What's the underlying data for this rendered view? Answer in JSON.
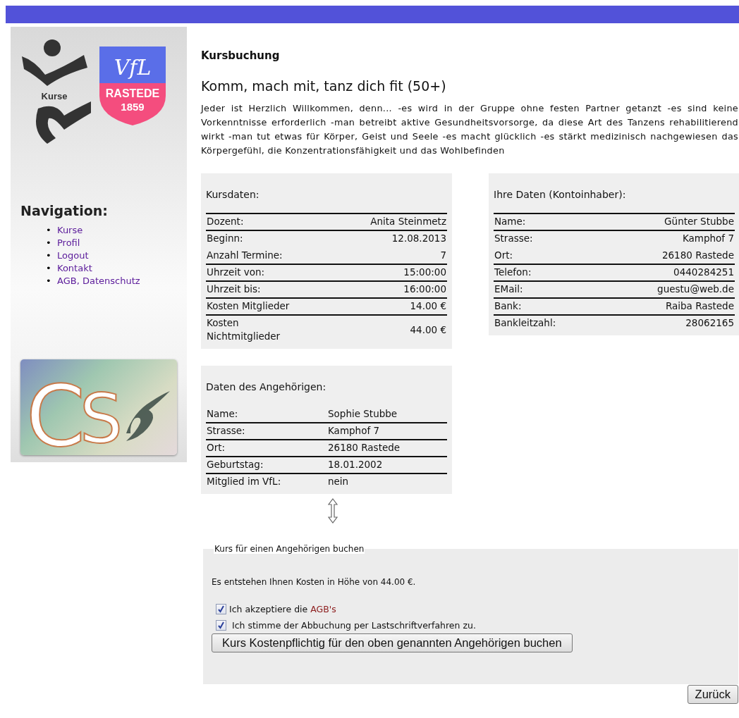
{
  "sidebar": {
    "logo_text": "Kurse",
    "club_logo": {
      "name": "VfL",
      "lines": [
        "RASTEDE",
        "1859"
      ]
    },
    "nav_title": "Navigation:",
    "nav_items": [
      {
        "bullet": "•",
        "label": "Kurse"
      },
      {
        "bullet": "•",
        "label": "Profil"
      },
      {
        "bullet": "•",
        "label": "Logout"
      },
      {
        "bullet": "•",
        "label": "Kontakt"
      },
      {
        "bullet": "•",
        "label": "AGB, Datenschutz"
      }
    ],
    "badge_letters": [
      "C",
      "S"
    ]
  },
  "page_title": "Kursbuchung",
  "course_title": "Komm, mach mit, tanz dich fit (50+)",
  "description": "Jeder ist Herzlich Willkommen, denn... -es wird in der Gruppe ohne festen Partner getanzt -es sind keine Vorkenntnisse erforderlich -man betreibt aktive Gesundheitsvorsorge, da diese Art des Tanzens rehabilitierend wirkt -man tut etwas für Körper, Geist und Seele -es macht glücklich -es stärkt medizinisch nachgewiesen das Körpergefühl, die Konzentrationsfähigkeit und das Wohlbefinden",
  "course_data": {
    "title": "Kursdaten:",
    "rows": [
      {
        "label": "Dozent:",
        "value": "Anita Steinmetz",
        "rule_above": true
      },
      {
        "label": "Beginn:",
        "value": "12.08.2013",
        "rule_above": true
      },
      {
        "label": "Anzahl Termine:",
        "value": "7",
        "rule_above": false
      },
      {
        "label": "Uhrzeit von:",
        "value": "15:00:00",
        "rule_above": true
      },
      {
        "label": "Uhrzeit bis:",
        "value": "16:00:00",
        "rule_above": true
      },
      {
        "label": "Kosten Mitglieder",
        "value": "14.00 €",
        "rule_above": true
      },
      {
        "label": "Kosten Nichtmitglieder",
        "value": "44.00 €",
        "rule_above": true
      }
    ]
  },
  "account_holder": {
    "title": "Ihre Daten (Kontoinhaber):",
    "rows": [
      {
        "label": "Name:",
        "value": "Günter Stubbe",
        "rule_above": true
      },
      {
        "label": "Strasse:",
        "value": "Kamphof 7",
        "rule_above": true
      },
      {
        "label": "Ort:",
        "value": "26180 Rastede",
        "rule_above": false
      },
      {
        "label": "Telefon:",
        "value": "0440284251",
        "rule_above": true
      },
      {
        "label": "EMail:",
        "value": "guestu@web.de",
        "rule_above": true
      },
      {
        "label": "Bank:",
        "value": "Raiba Rastede",
        "rule_above": true
      },
      {
        "label": "Bankleitzahl:",
        "value": "28062165",
        "rule_above": true
      }
    ]
  },
  "relative": {
    "title": "Daten des Angehörigen:",
    "rows": [
      {
        "label": "Name:",
        "value": "Sophie Stubbe",
        "rule_above": false
      },
      {
        "label": "Strasse:",
        "value": "Kamphof 7",
        "rule_above": true
      },
      {
        "label": "Ort:",
        "value": "26180 Rastede",
        "rule_above": true
      },
      {
        "label": "Geburtstag:",
        "value": "18.01.2002",
        "rule_above": true
      },
      {
        "label": "Mitglied im VfL:",
        "value": "nein",
        "rule_above": true
      }
    ]
  },
  "booking": {
    "legend": "Kurs für einen Angehörigen buchen",
    "cost_note": "Es entstehen Ihnen Kosten in Höhe von 44.00 €.",
    "checkboxes": [
      {
        "label": "Ich akzeptiere die",
        "link": "AGB's",
        "checked": true
      },
      {
        "label": "Ich stimme der Abbuchung per Lastschriftverfahren zu.",
        "checked": true
      }
    ],
    "submit": "Kurs Kostenpflichtig für den oben genannten Angehörigen buchen"
  },
  "back_button": "Zurück"
}
